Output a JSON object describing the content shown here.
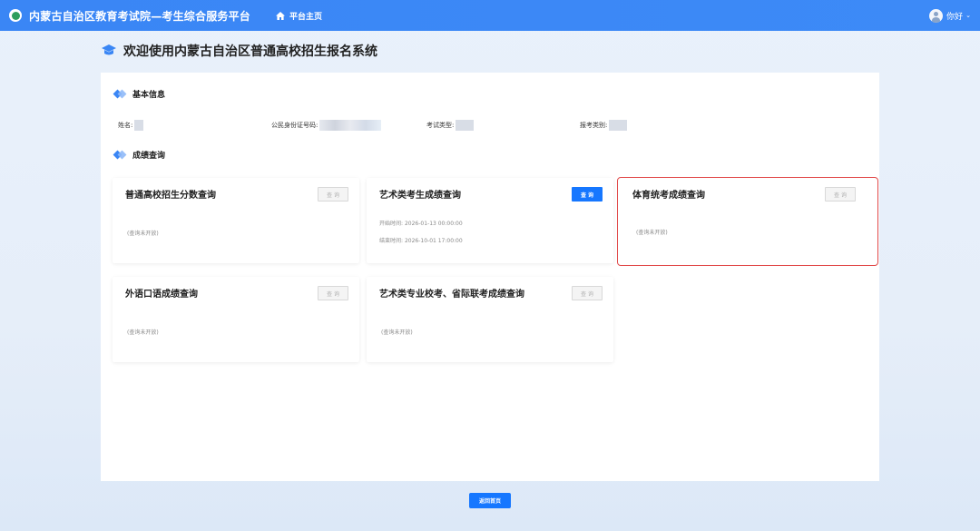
{
  "topbar": {
    "site_title": "内蒙古自治区教育考试院—考生综合服务平台",
    "nav_home": "平台主页",
    "user_greeting": "你好"
  },
  "page_title": "欢迎使用内蒙古自治区普通高校招生报名系统",
  "basic_info": {
    "heading": "基本信息",
    "name_label": "姓名:",
    "id_label": "公民身份证号码:",
    "exam_type_label": "考试类型:",
    "category_label": "报考类别:"
  },
  "scores": {
    "heading": "成绩查询",
    "cards": [
      {
        "title": "普通高校招生分数查询",
        "button": "查 询",
        "note": "(查询未开放)"
      },
      {
        "title": "艺术类考生成绩查询",
        "button": "查 询",
        "start_label": "开始时间:",
        "start_time": "2026-01-13 00:00:00",
        "end_label": "结束时间:",
        "end_time": "2026-10-01 17:00:00"
      },
      {
        "title": "体育统考成绩查询",
        "button": "查 询",
        "note": "(查询未开放)"
      },
      {
        "title": "外语口语成绩查询",
        "button": "查 询",
        "note": "(查询未开放)"
      },
      {
        "title": "艺术类专业校考、省际联考成绩查询",
        "button": "查 询",
        "note": "(查询未开放)"
      }
    ]
  },
  "back_button": "返回首页",
  "colors": {
    "primary": "#1677ff",
    "topbar": "#3a86f5",
    "highlight_border": "#e14a4a"
  }
}
